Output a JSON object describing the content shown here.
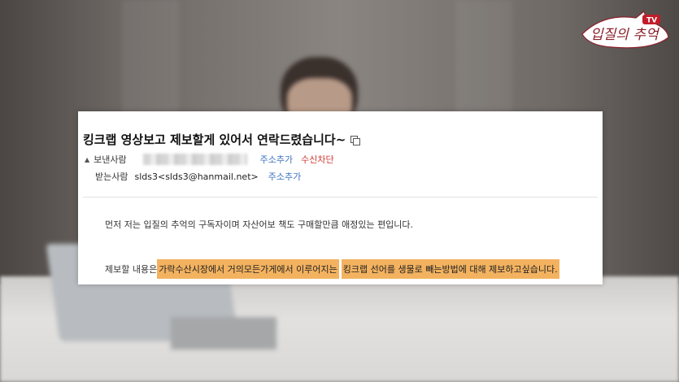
{
  "logo": {
    "text": "입질의 추억",
    "badge": "TV"
  },
  "email": {
    "subject": "킹크랩 영상보고 제보할게 있어서 연락드렸습니다~",
    "sender_label": "보낸사람",
    "recipient_label": "받는사람",
    "recipient": "slds3<slds3@hanmail.net>",
    "add_address": "주소추가",
    "block": "수신차단",
    "body_line1": "먼저 저는 입질의 추억의 구독자이며 자산어보 책도 구매할만큼 애정있는 편입니다.",
    "body_line2_prefix": "제보할 내용은 ",
    "highlight1": "가락수산시장에서 거의모든가게에서 이루어지는",
    "highlight2": "킹크랩 선어를 생물로 빼는방법에 대해 제보하고싶습니다."
  },
  "colors": {
    "link": "#3d73c2",
    "block": "#d0352f",
    "highlight": "#f3b25f"
  }
}
